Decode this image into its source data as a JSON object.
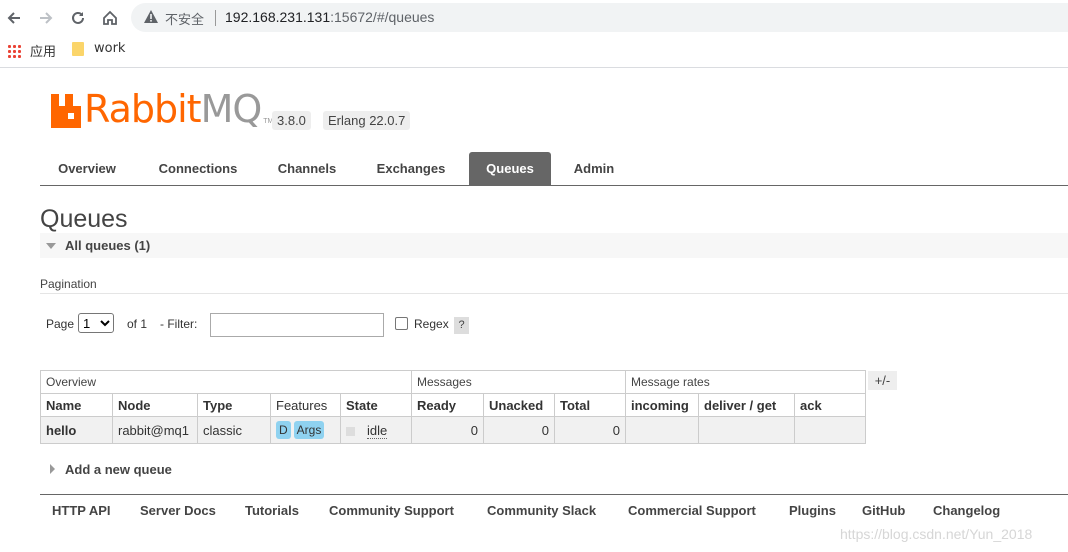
{
  "browser": {
    "insecure_label": "不安全",
    "url_host": "192.168.231.131",
    "url_path": ":15672/#/queues",
    "bookmarks": [
      {
        "label": "应用",
        "icon": "apps-grid-icon"
      },
      {
        "label": "work",
        "icon": "folder-icon"
      }
    ]
  },
  "header": {
    "logo_rabbit": "Rabbit",
    "logo_mq": "MQ",
    "logo_tm": "TM",
    "version": "3.8.0",
    "erlang": "Erlang 22.0.7"
  },
  "tabs": [
    {
      "label": "Overview"
    },
    {
      "label": "Connections"
    },
    {
      "label": "Channels"
    },
    {
      "label": "Exchanges"
    },
    {
      "label": "Queues",
      "active": true
    },
    {
      "label": "Admin"
    }
  ],
  "page": {
    "title": "Queues",
    "section_title": "All queues (1)",
    "pagination_label": "Pagination",
    "page_label": "Page",
    "page_value": "1",
    "of_label": "of 1",
    "filter_label": "- Filter:",
    "regex_label": "Regex",
    "help_label": "?"
  },
  "table": {
    "groups": [
      "Overview",
      "Messages",
      "Message rates"
    ],
    "columns": [
      "Name",
      "Node",
      "Type",
      "Features",
      "State",
      "Ready",
      "Unacked",
      "Total",
      "incoming",
      "deliver / get",
      "ack"
    ],
    "rows": [
      {
        "name": "hello",
        "node": "rabbit@mq1",
        "type": "classic",
        "features": [
          "D",
          "Args"
        ],
        "state": "idle",
        "ready": "0",
        "unacked": "0",
        "total": "0",
        "incoming": "",
        "deliver_get": "",
        "ack": ""
      }
    ],
    "toggle_label": "+/-"
  },
  "add_queue_label": "Add a new queue",
  "footer": [
    "HTTP API",
    "Server Docs",
    "Tutorials",
    "Community Support",
    "Community Slack",
    "Commercial Support",
    "Plugins",
    "GitHub",
    "Changelog"
  ],
  "watermark": "https://blog.csdn.net/Yun_2018",
  "colors": {
    "brand": "#ff6600",
    "active_tab": "#666666",
    "badge": "#8fd2f0"
  }
}
